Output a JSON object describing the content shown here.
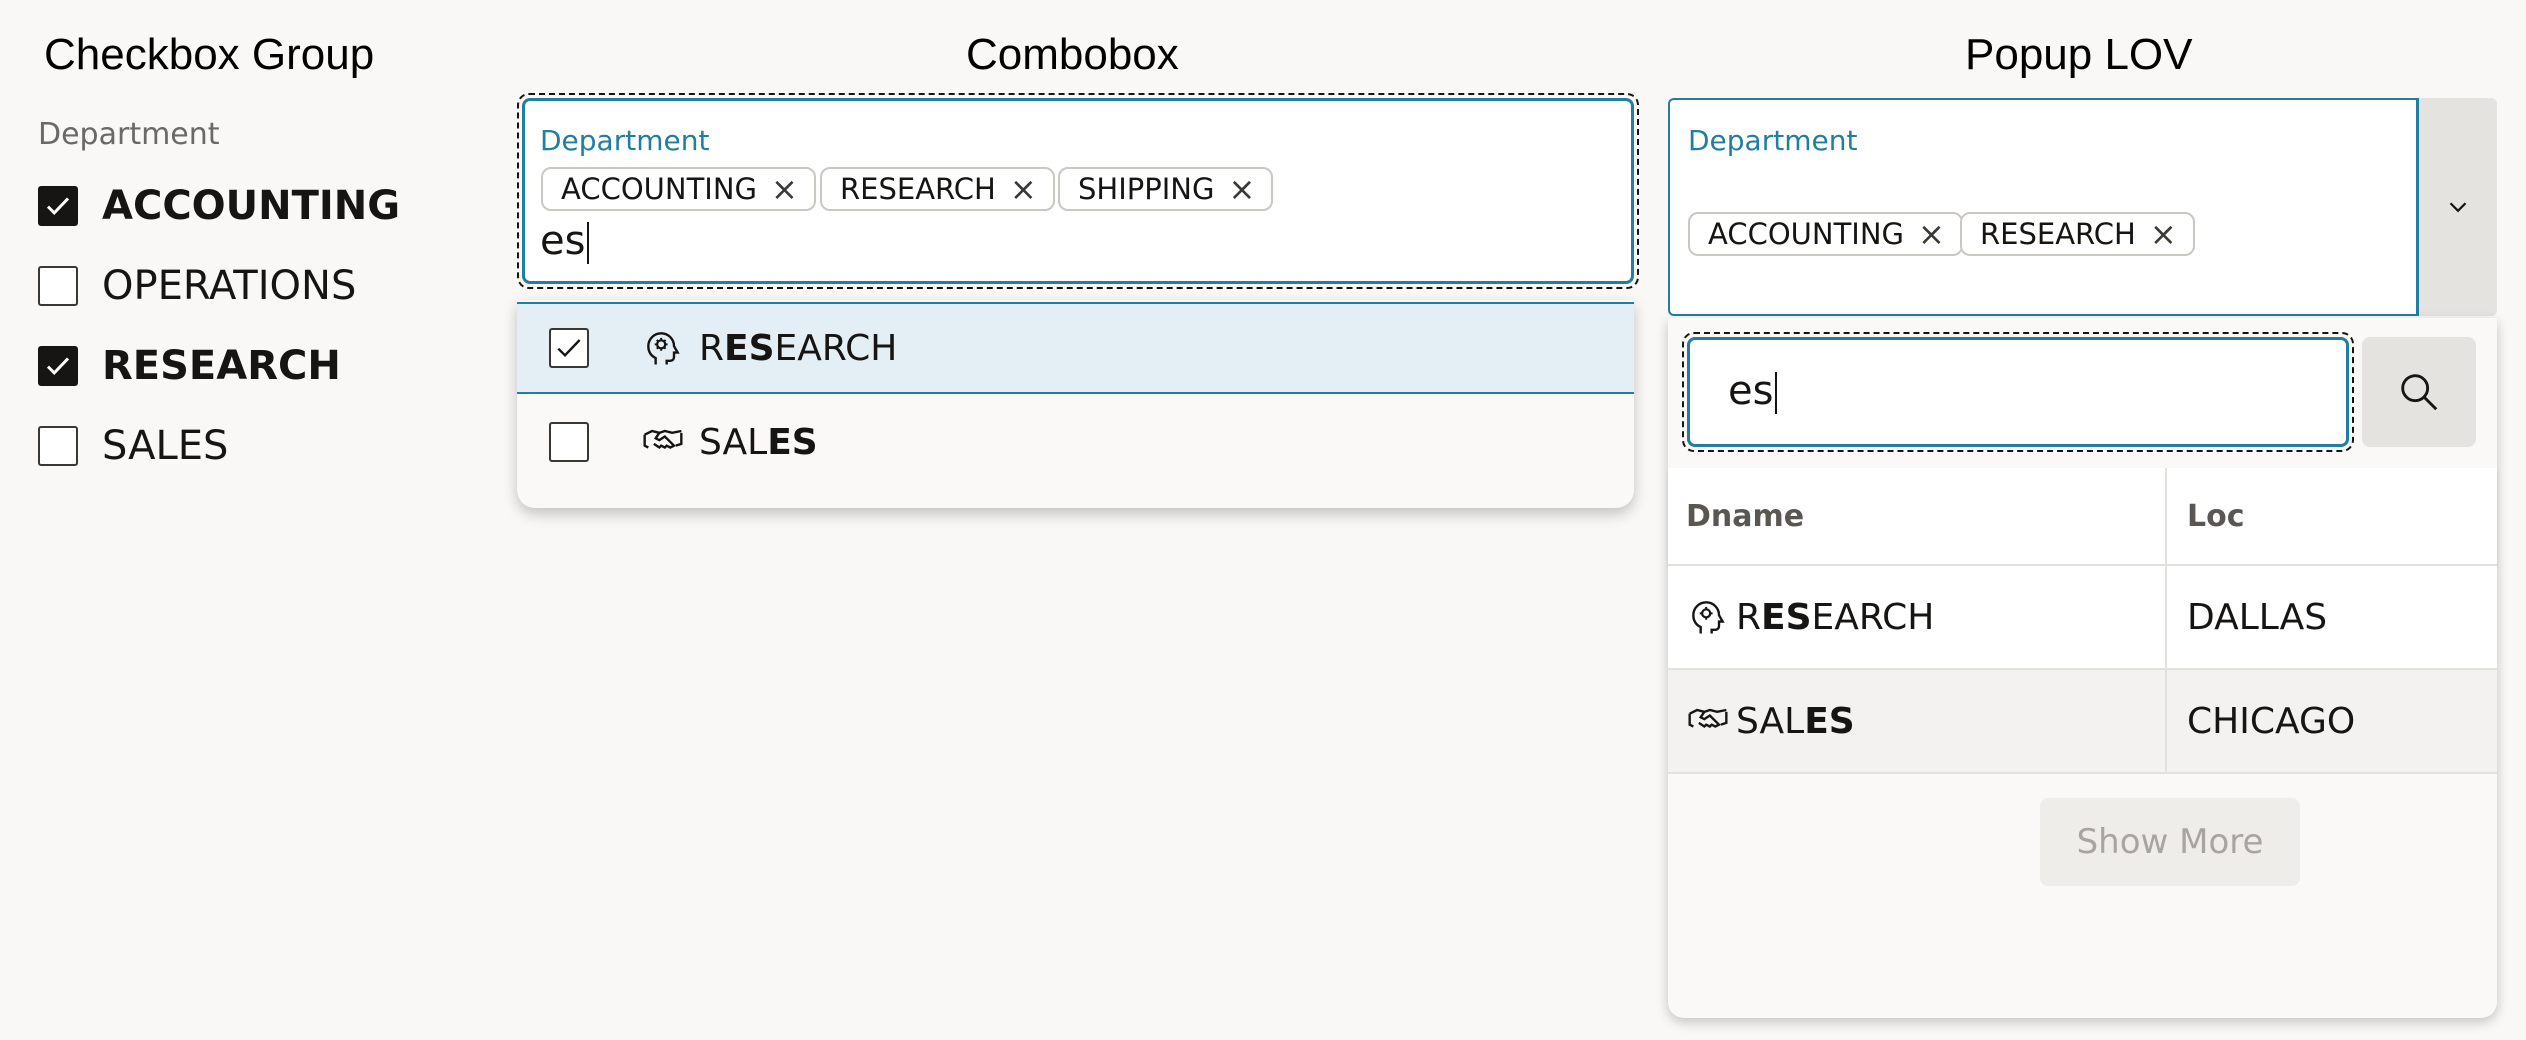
{
  "sections": {
    "checkbox_group_title": "Checkbox Group",
    "combobox_title": "Combobox",
    "popup_lov_title": "Popup LOV"
  },
  "checkbox_group": {
    "label": "Department",
    "items": [
      {
        "label": "ACCOUNTING",
        "checked": true
      },
      {
        "label": "OPERATIONS",
        "checked": false
      },
      {
        "label": "RESEARCH",
        "checked": true
      },
      {
        "label": "SALES",
        "checked": false
      }
    ]
  },
  "combobox": {
    "label": "Department",
    "chips": [
      "ACCOUNTING",
      "RESEARCH",
      "SHIPPING"
    ],
    "remove_icon": "×",
    "input_value": "es",
    "options": [
      {
        "pre": "R",
        "match": "ES",
        "post": "EARCH",
        "checked": true,
        "icon": "brain-head-icon"
      },
      {
        "pre": "SAL",
        "match": "ES",
        "post": "",
        "checked": false,
        "icon": "handshake-icon"
      }
    ]
  },
  "popup_lov": {
    "label": "Department",
    "chips": [
      "ACCOUNTING",
      "RESEARCH"
    ],
    "remove_icon": "×",
    "search_value": "es",
    "columns": [
      "Dname",
      "Loc"
    ],
    "rows": [
      {
        "pre": "R",
        "match": "ES",
        "post": "EARCH",
        "loc": "DALLAS",
        "icon": "brain-head-icon"
      },
      {
        "pre": "SAL",
        "match": "ES",
        "post": "",
        "loc": "CHICAGO",
        "icon": "handshake-icon"
      }
    ],
    "show_more_label": "Show More"
  },
  "colors": {
    "accent": "#227e9e",
    "highlight_row": "#e4eff5",
    "background": "#f9f8f6"
  }
}
